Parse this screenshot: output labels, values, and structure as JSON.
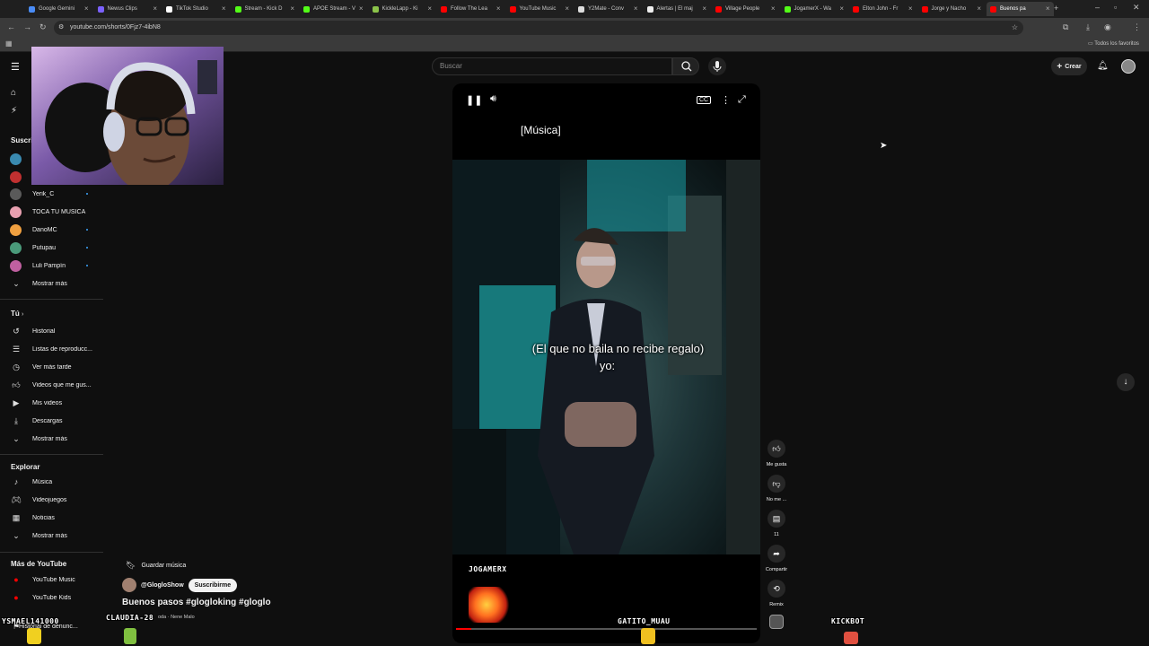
{
  "browser": {
    "tabs": [
      {
        "label": "Google Gemini",
        "color": "#4a8cf7"
      },
      {
        "label": "Newus Clips",
        "color": "#7b61ff"
      },
      {
        "label": "TikTok Studio",
        "color": "#ffffff"
      },
      {
        "label": "Stream - Kick D",
        "color": "#53fc18"
      },
      {
        "label": "APOE Stream - V",
        "color": "#53fc18"
      },
      {
        "label": "KickleLapp - Ki",
        "color": "#8bc34a"
      },
      {
        "label": "Follow The Lea",
        "color": "#ff0000"
      },
      {
        "label": "YouTube Music",
        "color": "#ff0000"
      },
      {
        "label": "Y2Mate - Conv",
        "color": "#dddddd"
      },
      {
        "label": "Alertas | El maj",
        "color": "#eeeeee"
      },
      {
        "label": "Village People",
        "color": "#ff0000"
      },
      {
        "label": "JogamerX - Wa",
        "color": "#53fc18"
      },
      {
        "label": "Elton John - Fr",
        "color": "#ff0000"
      },
      {
        "label": "Jorge y Nacho",
        "color": "#ff0000"
      },
      {
        "label": "Buenos pa",
        "color": "#ff0000"
      }
    ],
    "url": "youtube.com/shorts/0Fjz7-4ibN8",
    "bookmarks_label": "Todos los favoritos"
  },
  "youtube": {
    "search_placeholder": "Buscar",
    "create_label": "Crear"
  },
  "sidebar": {
    "subs_heading": "Suscri",
    "subscriptions": [
      {
        "label": "Yerik_C",
        "color": "#5a5a5a"
      },
      {
        "label": "TOCA TU MÚSICA",
        "color": "#e8a0b0"
      },
      {
        "label": "DanoMC",
        "color": "#f0a040"
      },
      {
        "label": "Putupau",
        "color": "#4a9a7a"
      },
      {
        "label": "Luli Pampín",
        "color": "#c060a0"
      }
    ],
    "show_more": "Mostrar más",
    "you_heading": "Tú",
    "you_items": [
      "Historial",
      "Listas de reproducc...",
      "Ver más tarde",
      "Videos que me gus...",
      "Mis videos",
      "Descargas",
      "Mostrar más"
    ],
    "explore_heading": "Explorar",
    "explore_items": [
      "Música",
      "Videojuegos",
      "Noticias",
      "Mostrar más"
    ],
    "more_heading": "Más de YouTube",
    "more_items": [
      "YouTube Music",
      "YouTube Kids"
    ],
    "report_history": "Historial de denunc..."
  },
  "player": {
    "caption_top": "[Música]",
    "caption_line1": "(El que no baila no recibe regalo)",
    "caption_line2": "yo:"
  },
  "actions": {
    "like": "Me gusta",
    "dislike": "No me ...",
    "comments": "11",
    "share": "Compartir",
    "remix": "Remix"
  },
  "short_meta": {
    "save_music": "Guardar música",
    "channel": "@GlogloShow",
    "subscribe": "Suscribirme",
    "title": "Buenos pasos #glogloking #gloglo",
    "music": "oda · Nene Malo"
  },
  "overlay": {
    "names": [
      "JOGAMERX",
      "GATITO_MUAU",
      "KICKBOT",
      "YSMAEL141000",
      "CLAUDIA-28"
    ]
  }
}
